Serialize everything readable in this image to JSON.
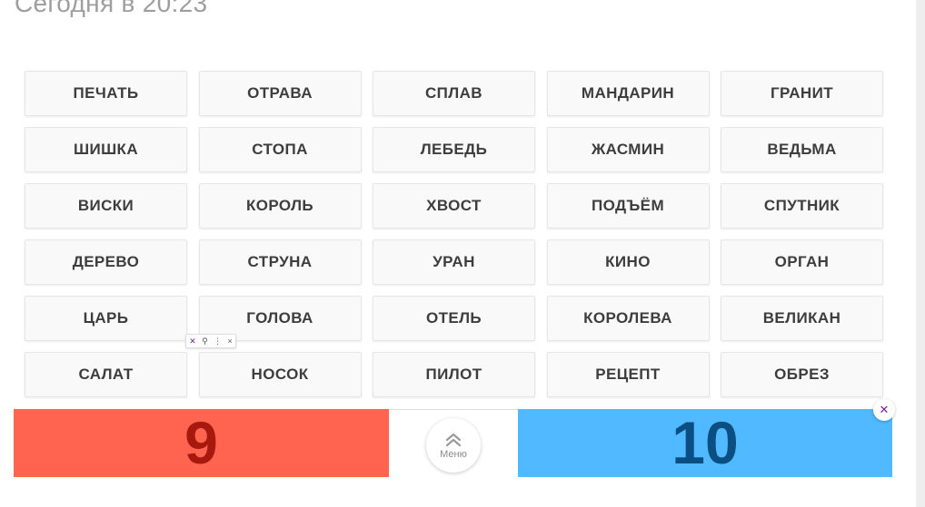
{
  "header": {
    "title": "Сегодня в 20:23"
  },
  "words": [
    "ПЕЧАТЬ",
    "ОТРАВА",
    "СПЛАВ",
    "МАНДАРИН",
    "ГРАНИТ",
    "ШИШКА",
    "СТОПА",
    "ЛЕБЕДЬ",
    "ЖАСМИН",
    "ВЕДЬМА",
    "ВИСКИ",
    "КОРОЛЬ",
    "ХВОСТ",
    "ПОДЪЁМ",
    "СПУТНИК",
    "ДЕРЕВО",
    "СТРУНА",
    "УРАН",
    "КИНО",
    "ОРГАН",
    "ЦАРЬ",
    "ГОЛОВА",
    "ОТЕЛЬ",
    "КОРОЛЕВА",
    "ВЕЛИКАН",
    "САЛАТ",
    "НОСОК",
    "ПИЛОТ",
    "РЕЦЕПТ",
    "ОБРЕЗ"
  ],
  "scores": {
    "red": "9",
    "blue": "10",
    "red_color": "#ff6450",
    "blue_color": "#50b9ff"
  },
  "menu": {
    "label": "Меню",
    "icon": "chevron-double-up-icon"
  },
  "overlay": {
    "toolbar_icons": [
      "bird-icon",
      "search-icon",
      "more-icon",
      "close-icon"
    ],
    "badge_icon": "bird-icon"
  }
}
